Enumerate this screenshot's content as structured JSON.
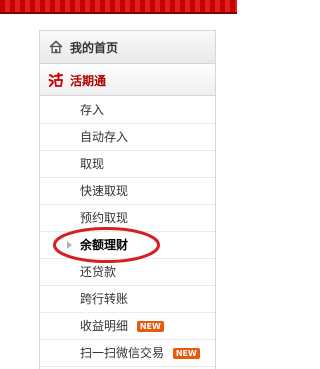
{
  "colors": {
    "brand_red": "#c40000",
    "badge_orange": "#e8590c",
    "annotation_red": "#d81e1e"
  },
  "sidebar": {
    "home": {
      "label": "我的首页",
      "icon": "home-icon"
    },
    "section": {
      "label": "活期通",
      "icon": "huoqitong-logo-icon"
    },
    "items": [
      {
        "label": "存入"
      },
      {
        "label": "自动存入"
      },
      {
        "label": "取现"
      },
      {
        "label": "快速取现"
      },
      {
        "label": "预约取现"
      },
      {
        "label": "余额理财",
        "active": true
      },
      {
        "label": "还贷款"
      },
      {
        "label": "跨行转账"
      },
      {
        "label": "收益明细",
        "badge": "NEW"
      },
      {
        "label": "扫一扫微信交易",
        "badge": "NEW"
      }
    ]
  }
}
